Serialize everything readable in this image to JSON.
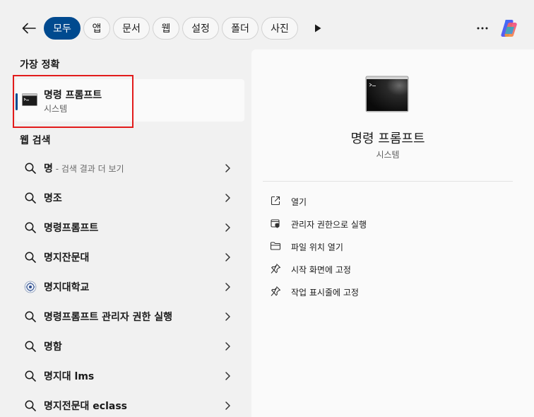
{
  "filters": {
    "chips": [
      "모두",
      "앱",
      "문서",
      "웹",
      "설정",
      "폴더",
      "사진"
    ],
    "active": "모두"
  },
  "colors": {
    "accent": "#004a8f",
    "highlight": "#e21b1b"
  },
  "best_match": {
    "title": "가장 정확",
    "name": "명령 프롬프트",
    "type": "시스템",
    "icon": "command-prompt-icon"
  },
  "web": {
    "title": "웹 검색",
    "items": [
      {
        "label": "명",
        "suffix": " - 검색 결과 더 보기",
        "icon": "search-icon"
      },
      {
        "label": "명조",
        "suffix": "",
        "icon": "search-icon"
      },
      {
        "label": "명령프롬프트",
        "suffix": "",
        "icon": "search-icon"
      },
      {
        "label": "명지잔문대",
        "suffix": "",
        "icon": "search-icon"
      },
      {
        "label": "명지대학교",
        "suffix": "",
        "icon": "university-emblem-icon"
      },
      {
        "label": "명령프롬프트 관리자 권한 실행",
        "suffix": "",
        "icon": "search-icon"
      },
      {
        "label": "명함",
        "suffix": "",
        "icon": "search-icon"
      },
      {
        "label": "명지대 lms",
        "suffix": "",
        "icon": "search-icon"
      },
      {
        "label": "명지전문대 eclass",
        "suffix": "",
        "icon": "search-icon"
      }
    ]
  },
  "detail": {
    "name": "명령 프롬프트",
    "type": "시스템",
    "actions": [
      {
        "label": "열기",
        "icon": "open-external-icon"
      },
      {
        "label": "관리자 권한으로 실행",
        "icon": "shield-admin-icon"
      },
      {
        "label": "파일 위치 열기",
        "icon": "folder-icon"
      },
      {
        "label": "시작 화면에 고정",
        "icon": "pin-icon"
      },
      {
        "label": "작업 표시줄에 고정",
        "icon": "pin-icon"
      }
    ]
  }
}
